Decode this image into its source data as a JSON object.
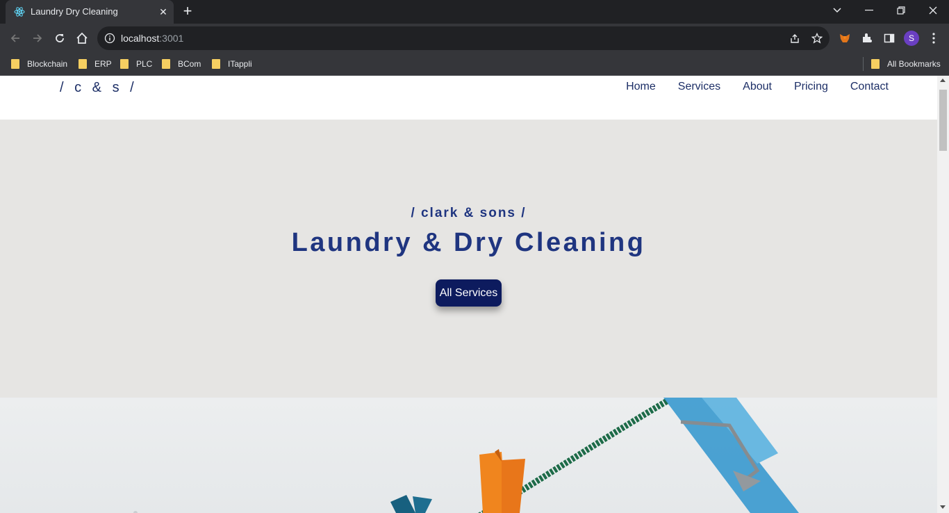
{
  "browser": {
    "tab_title": "Laundry Dry Cleaning",
    "url_host": "localhost",
    "url_port": ":3001",
    "avatar_letter": "S",
    "bookmarks": [
      "Blockchain",
      "ERP",
      "PLC",
      "BCom",
      "ITappli"
    ],
    "all_bookmarks": "All Bookmarks"
  },
  "site": {
    "logo": "/ c & s /",
    "nav": [
      "Home",
      "Services",
      "About",
      "Pricing",
      "Contact"
    ],
    "hero": {
      "subtitle": "/ clark & sons /",
      "title": "Laundry & Dry Cleaning",
      "button": "All Services"
    },
    "colors": {
      "brand": "#1f3580",
      "button": "#0d1b5e",
      "hero_bg": "#e6e5e3"
    }
  }
}
